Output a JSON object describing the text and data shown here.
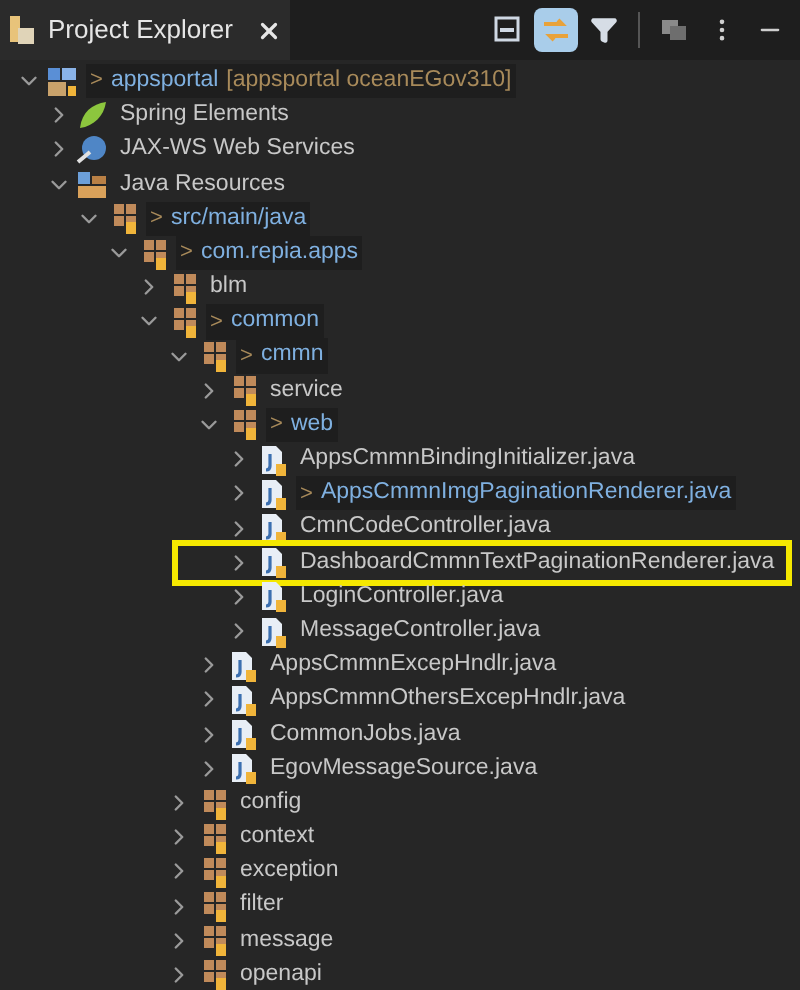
{
  "panel": {
    "title": "Project Explorer",
    "toolbar": [
      {
        "kind": "collapse",
        "selected": false
      },
      {
        "kind": "link",
        "selected": true
      },
      {
        "kind": "filter",
        "selected": false
      },
      {
        "kind": "focus",
        "selected": false
      },
      {
        "kind": "menu",
        "selected": false
      },
      {
        "kind": "minimize",
        "selected": false
      }
    ]
  },
  "tree": [
    {
      "kind": "project",
      "marker": ">",
      "label": "appsportal",
      "suffix": "[appsportal oceanEGov310]",
      "expanded": true,
      "children": [
        {
          "kind": "spring",
          "label": "Spring Elements",
          "expanded": false
        },
        {
          "kind": "webservice",
          "label": "JAX-WS Web Services",
          "expanded": false
        },
        {
          "kind": "resources",
          "label": "Java Resources",
          "expanded": true,
          "children": [
            {
              "kind": "source",
              "marker": ">",
              "label": "src/main/java",
              "expanded": true,
              "children": [
                {
                  "kind": "package",
                  "marker": ">",
                  "label": "com.repia.apps",
                  "expanded": true,
                  "children": [
                    {
                      "kind": "package",
                      "label": "blm",
                      "expanded": false
                    },
                    {
                      "kind": "package",
                      "marker": ">",
                      "label": "common",
                      "expanded": true,
                      "children": [
                        {
                          "kind": "package",
                          "marker": ">",
                          "label": "cmmn",
                          "expanded": true,
                          "children": [
                            {
                              "kind": "package",
                              "label": "service",
                              "expanded": false
                            },
                            {
                              "kind": "package",
                              "marker": ">",
                              "label": "web",
                              "expanded": true,
                              "children": [
                                {
                                  "kind": "file",
                                  "label": "AppsCmmnBindingInitializer.java",
                                  "expanded": false
                                },
                                {
                                  "kind": "file",
                                  "marker": ">",
                                  "label": "AppsCmmnImgPaginationRenderer.java",
                                  "expanded": false
                                },
                                {
                                  "kind": "file",
                                  "label": "CmnCodeController.java",
                                  "expanded": false
                                },
                                {
                                  "kind": "file",
                                  "label": "DashboardCmmnTextPaginationRenderer.java",
                                  "expanded": false,
                                  "highlighted": true
                                },
                                {
                                  "kind": "file",
                                  "label": "LoginController.java",
                                  "expanded": false
                                },
                                {
                                  "kind": "file",
                                  "label": "MessageController.java",
                                  "expanded": false
                                }
                              ]
                            },
                            {
                              "kind": "file",
                              "label": "AppsCmmnExcepHndlr.java",
                              "expanded": false
                            },
                            {
                              "kind": "file",
                              "label": "AppsCmmnOthersExcepHndlr.java",
                              "expanded": false
                            },
                            {
                              "kind": "file",
                              "label": "CommonJobs.java",
                              "expanded": false
                            },
                            {
                              "kind": "file",
                              "label": "EgovMessageSource.java",
                              "expanded": false
                            }
                          ]
                        },
                        {
                          "kind": "package",
                          "label": "config",
                          "expanded": false
                        },
                        {
                          "kind": "package",
                          "label": "context",
                          "expanded": false
                        },
                        {
                          "kind": "package",
                          "label": "exception",
                          "expanded": false
                        },
                        {
                          "kind": "package",
                          "label": "filter",
                          "expanded": false
                        },
                        {
                          "kind": "package",
                          "label": "message",
                          "expanded": false
                        },
                        {
                          "kind": "package",
                          "label": "openapi",
                          "expanded": false
                        }
                      ]
                    }
                  ]
                }
              ]
            }
          ]
        }
      ]
    }
  ]
}
